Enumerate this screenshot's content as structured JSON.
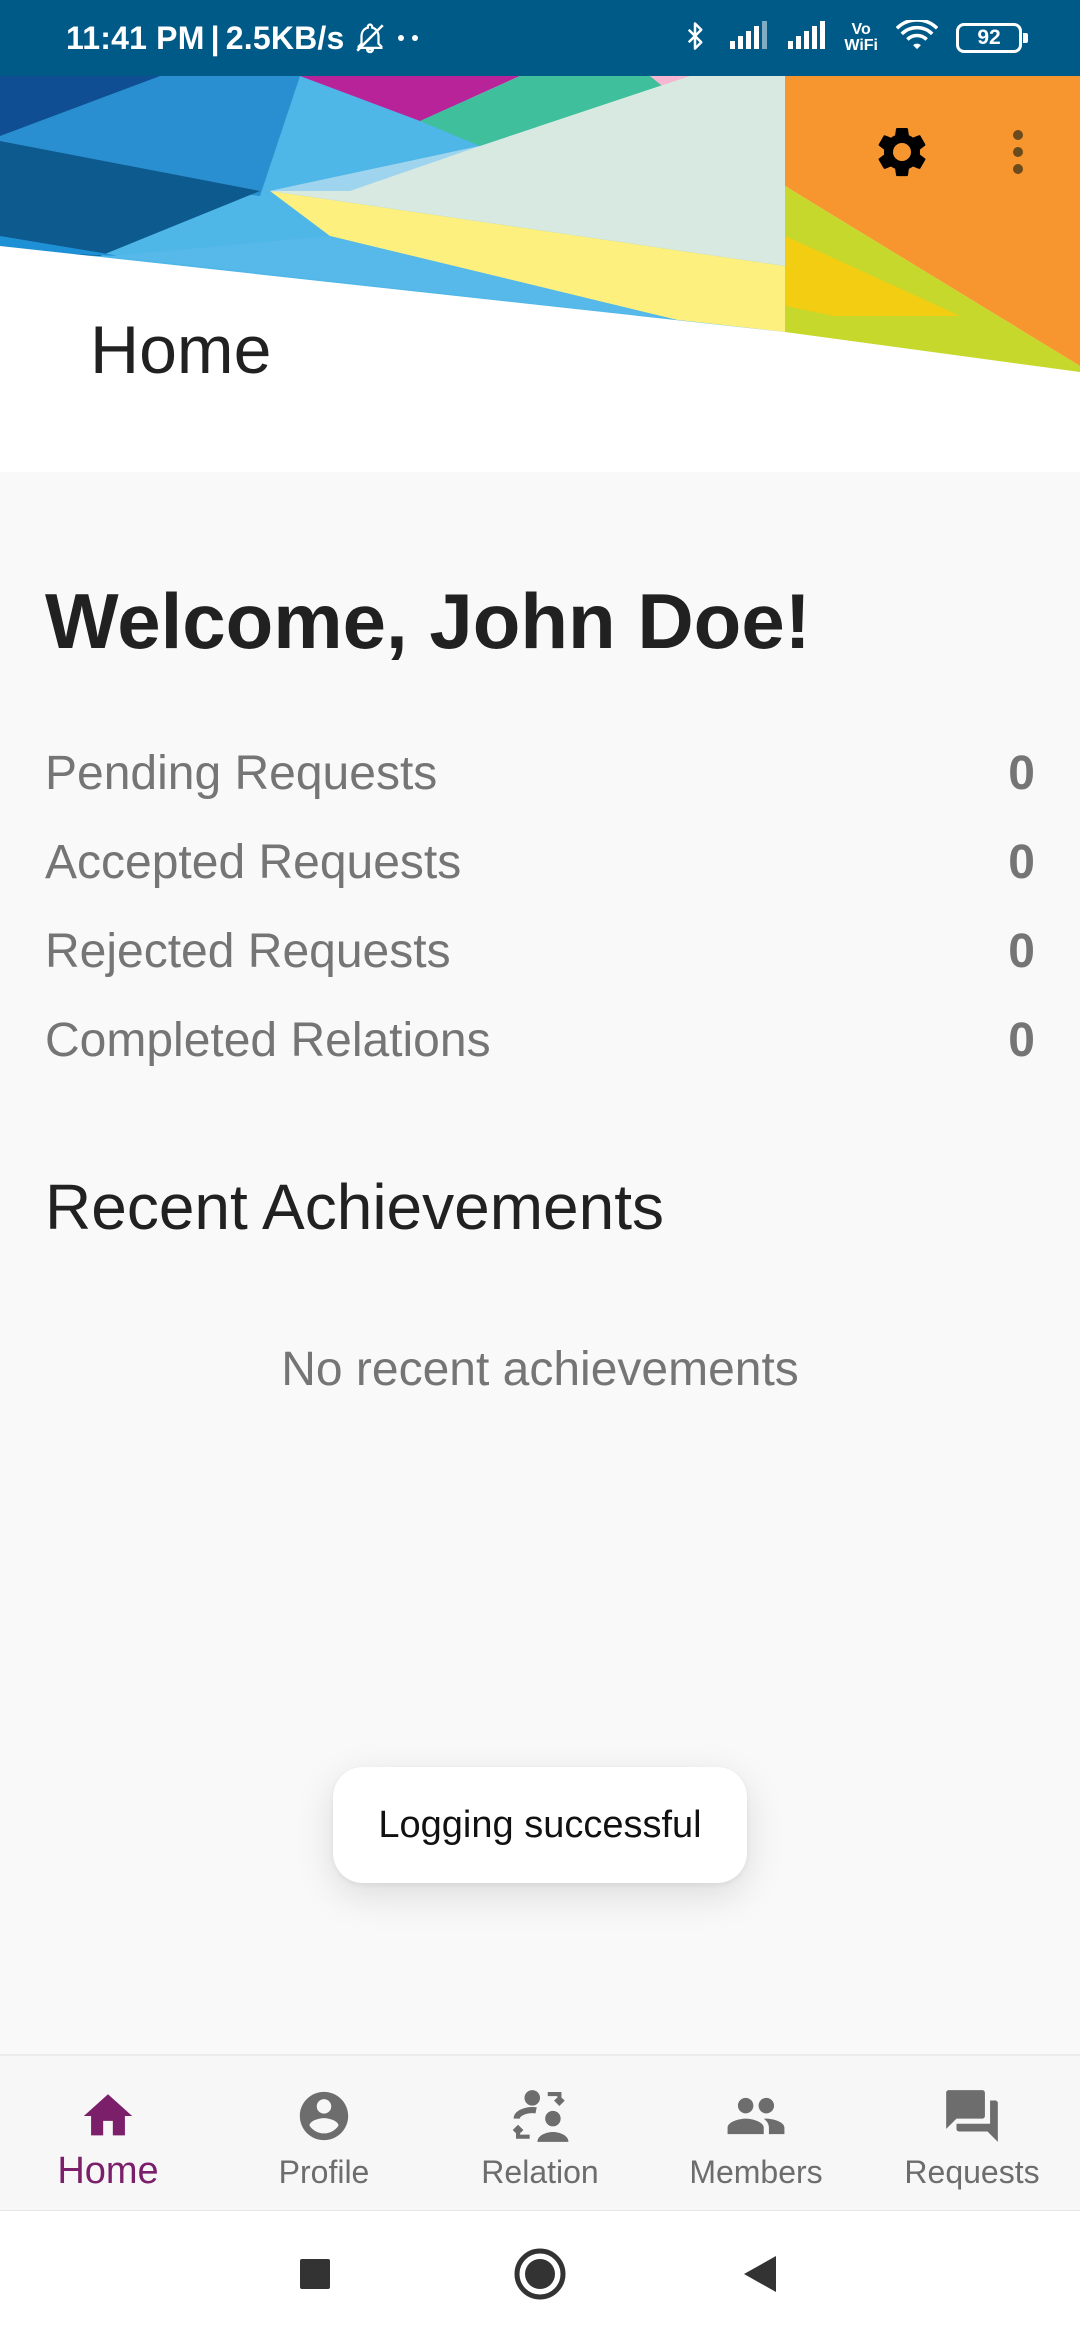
{
  "status_bar": {
    "time": "11:41 PM",
    "separator": "|",
    "net_speed": "2.5KB/s",
    "battery": "92",
    "icons": [
      "mute-notification-icon",
      "more-dots-icon",
      "bluetooth-icon",
      "signal-icon",
      "signal-icon",
      "vowifi-icon",
      "wifi-icon",
      "battery-icon"
    ],
    "vowifi_top": "Vo",
    "vowifi_bottom": "WiFi"
  },
  "header": {
    "title": "Home",
    "actions": [
      "gear-icon",
      "more-vertical-icon"
    ]
  },
  "main": {
    "welcome": "Welcome, John Doe!",
    "stats": [
      {
        "label": "Pending Requests",
        "value": "0"
      },
      {
        "label": "Accepted Requests",
        "value": "0"
      },
      {
        "label": "Rejected Requests",
        "value": "0"
      },
      {
        "label": "Completed Relations",
        "value": "0"
      }
    ],
    "achievements_title": "Recent Achievements",
    "achievements_empty": "No recent achievements"
  },
  "toast": {
    "message": "Logging successful"
  },
  "bottom_nav": {
    "items": [
      {
        "label": "Home",
        "icon": "home-icon",
        "active": true
      },
      {
        "label": "Profile",
        "icon": "account-circle-icon",
        "active": false
      },
      {
        "label": "Relation",
        "icon": "relation-swap-icon",
        "active": false
      },
      {
        "label": "Members",
        "icon": "group-icon",
        "active": false
      },
      {
        "label": "Requests",
        "icon": "forum-icon",
        "active": false
      }
    ]
  },
  "system_nav": {
    "buttons": [
      "recents-square-icon",
      "home-circle-icon",
      "back-triangle-icon"
    ]
  },
  "colors": {
    "status_bar": "#005a87",
    "accent": "#7b1f6a",
    "text_primary": "#212121",
    "text_secondary": "#757575",
    "background": "#f9f9f9"
  }
}
